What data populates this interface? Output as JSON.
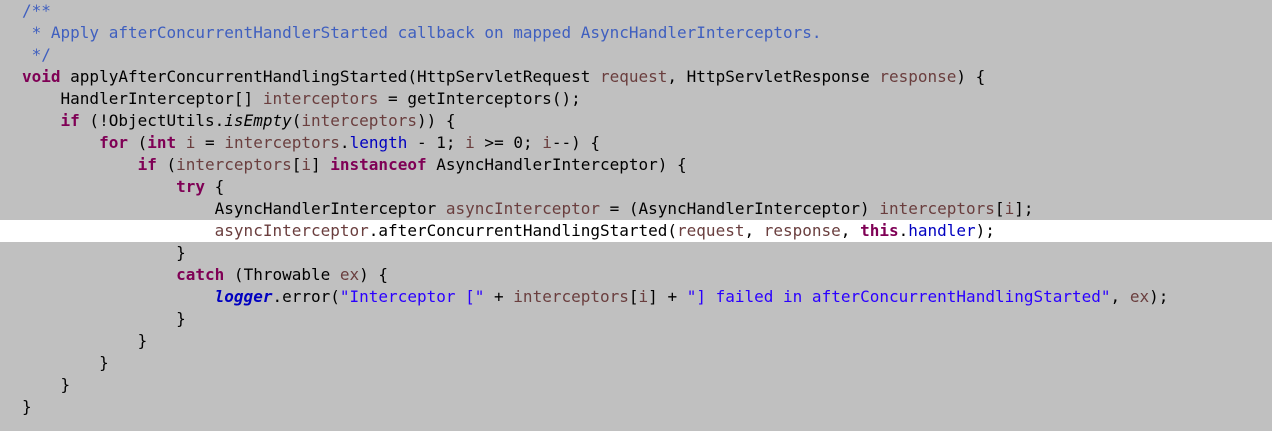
{
  "code_lines": [
    {
      "tokens": [
        [
          "cm",
          "/**"
        ]
      ]
    },
    {
      "tokens": [
        [
          "cm",
          " * Apply afterConcurrentHandlerStarted callback on mapped AsyncHandlerInterceptors."
        ]
      ]
    },
    {
      "tokens": [
        [
          "cm",
          " */"
        ]
      ]
    },
    {
      "tokens": [
        [
          "kw",
          "void"
        ],
        [
          "",
          " applyAfterConcurrentHandlingStarted(HttpServletRequest "
        ],
        [
          "param",
          "request"
        ],
        [
          "",
          ", HttpServletResponse "
        ],
        [
          "param",
          "response"
        ],
        [
          "",
          ") {"
        ]
      ]
    },
    {
      "tokens": [
        [
          "",
          "    HandlerInterceptor[] "
        ],
        [
          "param",
          "interceptors"
        ],
        [
          "",
          " = getInterceptors();"
        ]
      ]
    },
    {
      "tokens": [
        [
          "",
          "    "
        ],
        [
          "kw",
          "if"
        ],
        [
          "",
          " (!ObjectUtils."
        ],
        [
          "it",
          "isEmpty"
        ],
        [
          "",
          "("
        ],
        [
          "param",
          "interceptors"
        ],
        [
          "",
          ")) {"
        ]
      ]
    },
    {
      "tokens": [
        [
          "",
          "        "
        ],
        [
          "kw",
          "for"
        ],
        [
          "",
          " ("
        ],
        [
          "kw",
          "int"
        ],
        [
          "",
          " "
        ],
        [
          "param",
          "i"
        ],
        [
          "",
          " = "
        ],
        [
          "param",
          "interceptors"
        ],
        [
          "",
          "."
        ],
        [
          "fld",
          "length"
        ],
        [
          "",
          " - 1; "
        ],
        [
          "param",
          "i"
        ],
        [
          "",
          " >= 0; "
        ],
        [
          "param",
          "i"
        ],
        [
          "",
          "--) {"
        ]
      ]
    },
    {
      "tokens": [
        [
          "",
          "            "
        ],
        [
          "kw",
          "if"
        ],
        [
          "",
          " ("
        ],
        [
          "param",
          "interceptors"
        ],
        [
          "",
          "["
        ],
        [
          "param",
          "i"
        ],
        [
          "",
          "] "
        ],
        [
          "kw",
          "instanceof"
        ],
        [
          "",
          " AsyncHandlerInterceptor) {"
        ]
      ]
    },
    {
      "tokens": [
        [
          "",
          "                "
        ],
        [
          "kw",
          "try"
        ],
        [
          "",
          " {"
        ]
      ]
    },
    {
      "tokens": [
        [
          "",
          "                    AsyncHandlerInterceptor "
        ],
        [
          "param",
          "asyncInterceptor"
        ],
        [
          "",
          " = (AsyncHandlerInterceptor) "
        ],
        [
          "param",
          "interceptors"
        ],
        [
          "",
          "["
        ],
        [
          "param",
          "i"
        ],
        [
          "",
          "];"
        ]
      ]
    },
    {
      "current": true,
      "tokens": [
        [
          "",
          "                    "
        ],
        [
          "param",
          "asyncInterceptor"
        ],
        [
          "",
          ".afterConcurrentHandlingStarted("
        ],
        [
          "param",
          "request"
        ],
        [
          "",
          ", "
        ],
        [
          "param",
          "response"
        ],
        [
          "",
          ", "
        ],
        [
          "kw",
          "this"
        ],
        [
          "",
          "."
        ],
        [
          "fld",
          "handler"
        ],
        [
          "",
          ");"
        ]
      ]
    },
    {
      "tokens": [
        [
          "",
          "                }"
        ]
      ]
    },
    {
      "tokens": [
        [
          "",
          "                "
        ],
        [
          "kw",
          "catch"
        ],
        [
          "",
          " (Throwable "
        ],
        [
          "param",
          "ex"
        ],
        [
          "",
          ") {"
        ]
      ]
    },
    {
      "tokens": [
        [
          "",
          "                    "
        ],
        [
          "sfld",
          "logger"
        ],
        [
          "",
          ".error("
        ],
        [
          "str",
          "\"Interceptor [\""
        ],
        [
          "",
          " + "
        ],
        [
          "param",
          "interceptors"
        ],
        [
          "",
          "["
        ],
        [
          "param",
          "i"
        ],
        [
          "",
          "] + "
        ],
        [
          "str",
          "\"] failed in afterConcurrentHandlingStarted\""
        ],
        [
          "",
          ", "
        ],
        [
          "param",
          "ex"
        ],
        [
          "",
          ");"
        ]
      ]
    },
    {
      "tokens": [
        [
          "",
          "                }"
        ]
      ]
    },
    {
      "tokens": [
        [
          "",
          "            }"
        ]
      ]
    },
    {
      "tokens": [
        [
          "",
          "        }"
        ]
      ]
    },
    {
      "tokens": [
        [
          "",
          "    }"
        ]
      ]
    },
    {
      "tokens": [
        [
          "",
          "}"
        ]
      ]
    }
  ]
}
